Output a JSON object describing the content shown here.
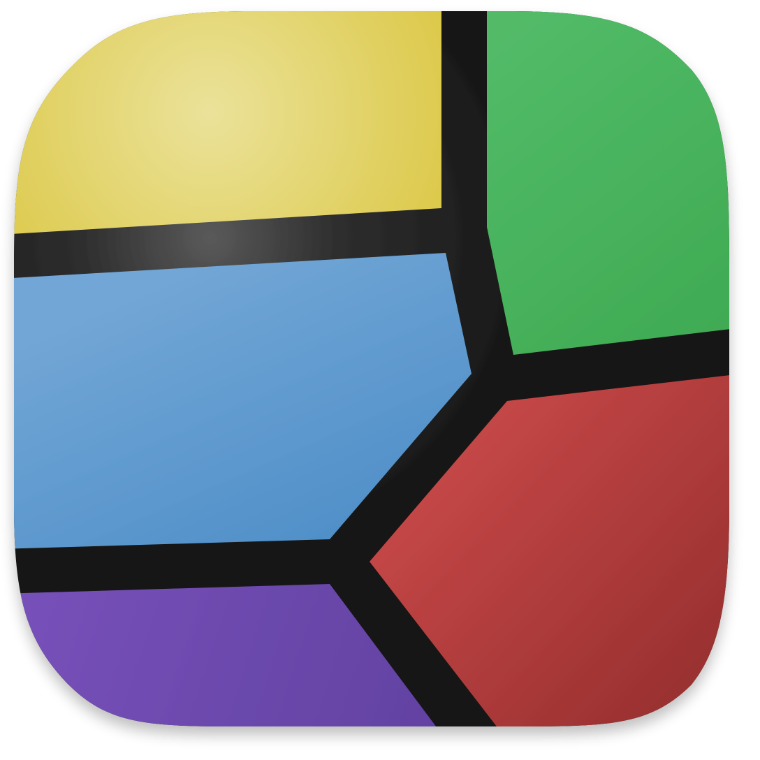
{
  "icon": {
    "name": "voronoi-app-icon",
    "shape": "squircle",
    "background": "#1a1a1a",
    "cells": [
      {
        "name": "yellow-cell",
        "color": "#dcc94a",
        "highlight": "#ebe29a"
      },
      {
        "name": "green-cell",
        "color": "#3eaa52",
        "highlight": "#52bb68"
      },
      {
        "name": "blue-cell",
        "color": "#4f8fc8",
        "highlight": "#72a6d6"
      },
      {
        "name": "red-cell",
        "color": "#b23c3c",
        "highlight": "#c74848"
      },
      {
        "name": "purple-cell",
        "color": "#6a48ac",
        "highlight": "#7650b8"
      }
    ]
  }
}
